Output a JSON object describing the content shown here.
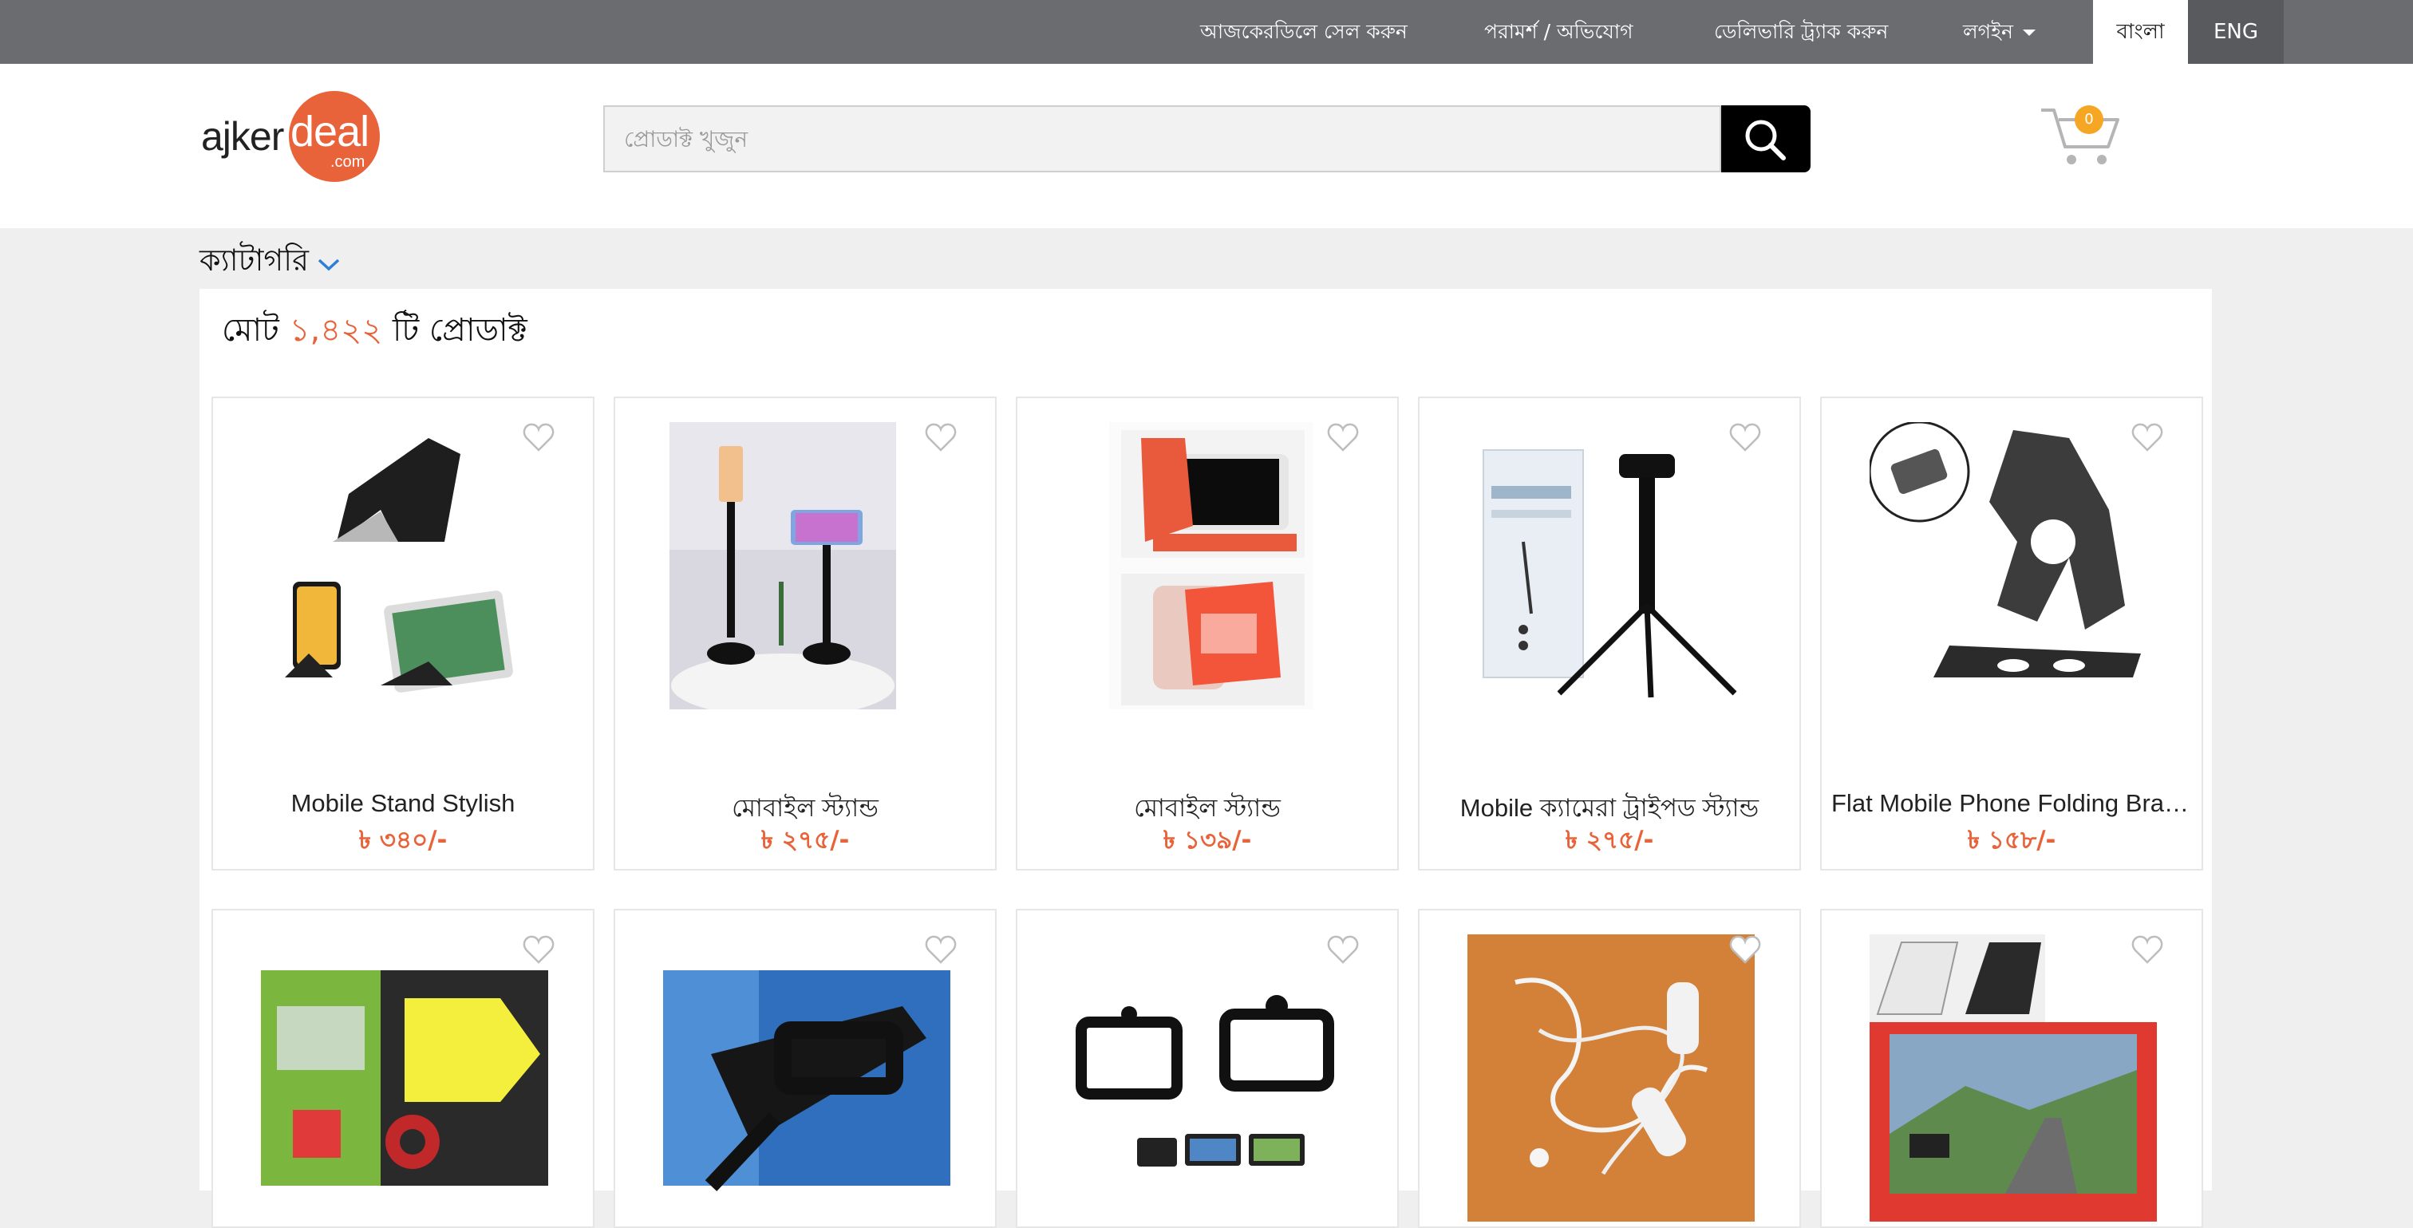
{
  "topbar": {
    "sell_link": "আজকেরডিলে সেল করুন",
    "feedback_link": "পরামর্শ / অভিযোগ",
    "track_link": "ডেলিভারি ট্র্যাক করুন",
    "login_label": "লগইন",
    "lang_bn": "বাংলা",
    "lang_en": "ENG"
  },
  "header": {
    "logo": {
      "ajker": "ajker",
      "deal": "deal",
      "com": ".com"
    },
    "search_placeholder": "প্রোডাক্ট খুজুন",
    "cart_count": "0"
  },
  "category": {
    "label": "ক্যাটাগরি"
  },
  "summary": {
    "prefix": "মোট",
    "count": "১,৪২২",
    "suffix": "টি প্রোডাক্ট"
  },
  "products": [
    {
      "name": "Mobile Stand Stylish",
      "price": "৳ ৩৪০/-",
      "image": "black-folding-tablet-stand"
    },
    {
      "name": "মোবাইল স্ট্যান্ড",
      "price": "৳ ২৭৫/-",
      "image": "desk-phone-holders"
    },
    {
      "name": "মোবাইল স্ট্যান্ড",
      "price": "৳ ১৩৯/-",
      "image": "orange-phone-stand"
    },
    {
      "name": "Mobile ক্যামেরা ট্রাইপড স্ট্যান্ড",
      "price": "৳ ২৭৫/-",
      "image": "tripod-with-box"
    },
    {
      "name": "Flat Mobile Phone Folding Bracket",
      "price": "৳ ১৫৮/-",
      "image": "metal-folding-bracket"
    },
    {
      "name": "",
      "price": "",
      "image": "bike-phone-holder-box"
    },
    {
      "name": "",
      "price": "",
      "image": "black-clip-holder"
    },
    {
      "name": "",
      "price": "",
      "image": "selfie-clip-holders"
    },
    {
      "name": "",
      "price": "",
      "image": "white-earphones"
    },
    {
      "name": "",
      "price": "",
      "image": "screen-magnifier"
    }
  ],
  "colors": {
    "topbar_bg": "#6b6c70",
    "accent": "#e8623a",
    "cart_badge": "#f5a623",
    "page_bg": "#efefef"
  },
  "icons": [
    "search-icon",
    "cart-icon",
    "heart-icon",
    "chevron-down-icon",
    "caret-down-icon"
  ]
}
